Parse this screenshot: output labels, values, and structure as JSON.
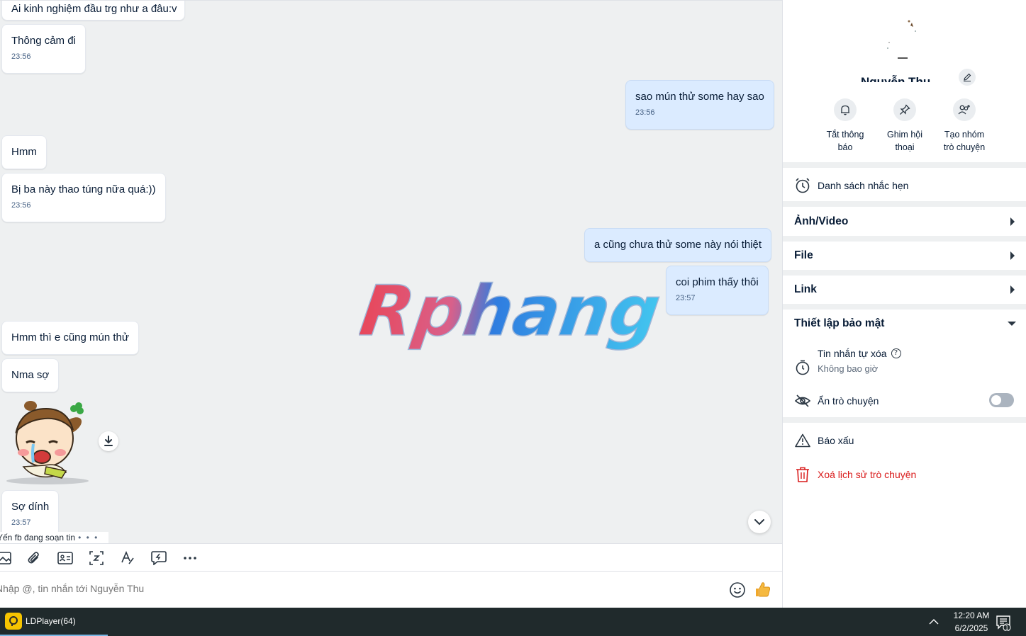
{
  "messages": [
    {
      "text": "Ai kinh nghiệm đầu trg như a đâu:v",
      "time": ""
    },
    {
      "text": "Thông cảm đi",
      "time": "23:56"
    },
    {
      "text": "sao mún thử some hay sao",
      "time": "23:56"
    },
    {
      "text": "Hmm",
      "time": ""
    },
    {
      "text": "Bị ba này thao túng nữa quá:))",
      "time": "23:56"
    },
    {
      "text": "a cũng chưa thử some này nói thiệt",
      "time": ""
    },
    {
      "text": "coi phim thấy thôi",
      "time": "23:57"
    },
    {
      "text": "Hmm thì e cũng mún thử",
      "time": ""
    },
    {
      "text": "Nma sợ",
      "time": ""
    },
    {
      "text": "Sợ dính",
      "time": "23:57"
    }
  ],
  "watermark": "Rphang",
  "typing": {
    "text": "Yến fb đang soạn tin",
    "dots": "• • •"
  },
  "composer": {
    "placeholder": "Nhập @, tin nhắn tới Nguyễn Thu"
  },
  "panel": {
    "actions": [
      {
        "label_line1": "Tắt thông",
        "label_line2": "báo",
        "icon": "bell-icon"
      },
      {
        "label_line1": "Ghim hội",
        "label_line2": "thoại",
        "icon": "pin-icon"
      },
      {
        "label_line1": "Tạo nhóm",
        "label_line2": "trò chuyện",
        "icon": "add-group-icon"
      }
    ],
    "reminder": "Danh sách nhắc hẹn",
    "sections": {
      "media": "Ảnh/Video",
      "file": "File",
      "link": "Link",
      "security": "Thiết lập bảo mật"
    },
    "self_delete": {
      "label": "Tin nhắn tự xóa",
      "value": "Không bao giờ"
    },
    "hide_chat": {
      "label": "Ẩn trò chuyện",
      "enabled": false
    },
    "report": "Báo xấu",
    "delete_history": "Xoá lịch sử trò chuyện"
  },
  "taskbar": {
    "app": "LDPlayer(64)",
    "time": "12:20 AM",
    "date": "6/2/2025",
    "notification_count": "1"
  },
  "colors": {
    "accent": "#0068ff",
    "my_bubble": "#dbebff",
    "danger": "#d91b1b"
  }
}
